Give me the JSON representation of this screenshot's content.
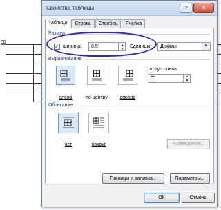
{
  "dialog": {
    "title": "Свойства таблицы",
    "help_label": "?",
    "close_label": "✕"
  },
  "tabs": [
    {
      "label": "Таблица",
      "selected": true
    },
    {
      "label": "Строка",
      "selected": false
    },
    {
      "label": "Столбец",
      "selected": false
    },
    {
      "label": "Ячейка",
      "selected": false
    }
  ],
  "size": {
    "section_label": "Размер",
    "width_checked": true,
    "width_label": "ширина:",
    "width_value": "0.5\"",
    "units_label": "Единицы:",
    "units_value": "Дюймы"
  },
  "alignment": {
    "section_label": "Выравнивание",
    "options": [
      {
        "label": "слева",
        "selected": true
      },
      {
        "label": "по центру",
        "selected": false
      },
      {
        "label": "справа",
        "selected": false
      }
    ],
    "indent_label": "отступ слева:",
    "indent_value": "0\""
  },
  "wrap": {
    "section_label": "Обтекание",
    "options": [
      {
        "label": "нет",
        "selected": true
      },
      {
        "label": "вокруг",
        "selected": false
      }
    ],
    "positioning_button": "Размещение..."
  },
  "buttons": {
    "borders": "Границы и заливка...",
    "options": "Параметры...",
    "ok": "ОК",
    "cancel": "Отмена"
  },
  "colors": {
    "highlight": "#3b1fd6",
    "titlebar": "#c3d7ee",
    "selected_option": "#dbe9f8"
  }
}
